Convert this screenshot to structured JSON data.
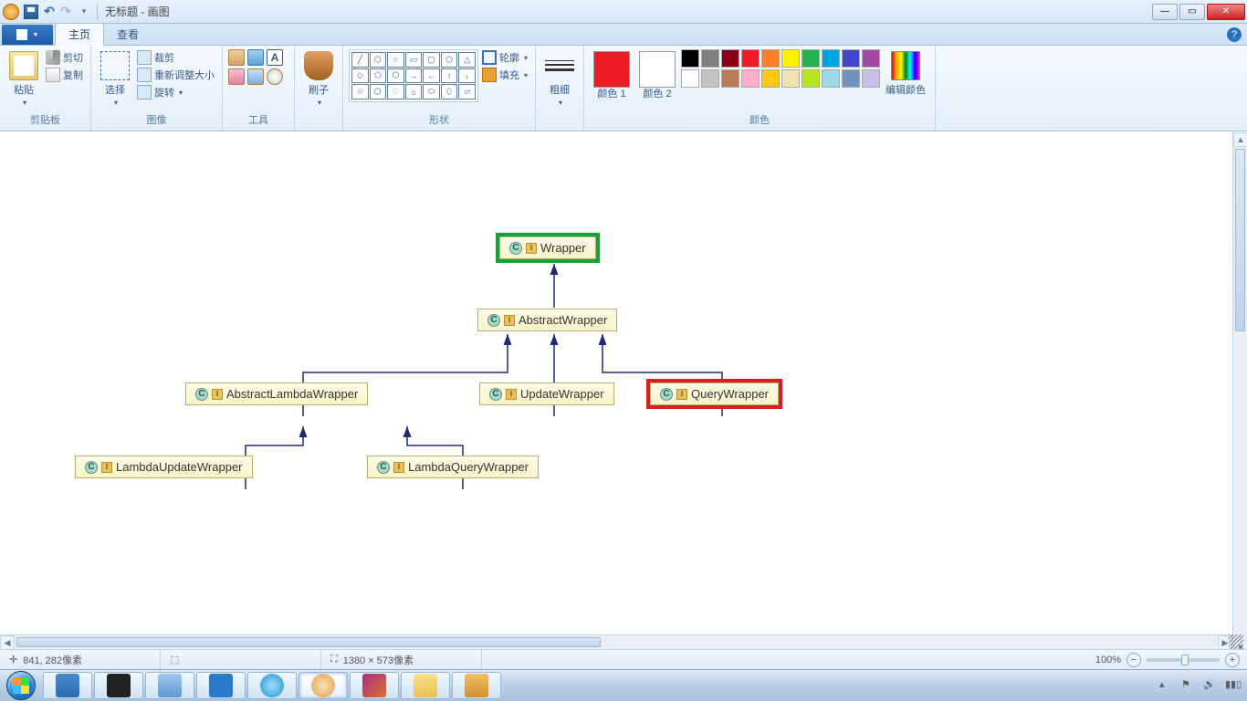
{
  "titlebar": {
    "title": "无标题 - 画图"
  },
  "tabs": {
    "file": "",
    "home": "主页",
    "view": "查看"
  },
  "ribbon": {
    "clipboard": {
      "label": "剪贴板",
      "paste": "粘贴",
      "cut": "剪切",
      "copy": "复制"
    },
    "image": {
      "label": "图像",
      "select": "选择",
      "crop": "裁剪",
      "resize": "重新调整大小",
      "rotate": "旋转"
    },
    "tools": {
      "label": "工具"
    },
    "brushes": {
      "label": "刷子"
    },
    "shapes": {
      "label": "形状",
      "outline": "轮廓",
      "fill": "填充"
    },
    "stroke": {
      "label": "粗细"
    },
    "colors": {
      "label": "颜色",
      "color1": "颜色 1",
      "color2": "颜色 2",
      "edit": "编辑颜色"
    }
  },
  "palette_row1": [
    "#000000",
    "#7f7f7f",
    "#880015",
    "#ed1c24",
    "#ff7f27",
    "#fff200",
    "#22b14c",
    "#00a2e8",
    "#3f48cc",
    "#a349a4"
  ],
  "palette_row2": [
    "#ffffff",
    "#c3c3c3",
    "#b97a57",
    "#ffaec9",
    "#ffc90e",
    "#efe4b0",
    "#b5e61d",
    "#99d9ea",
    "#7092be",
    "#c8bfe7"
  ],
  "current_color1": "#ed1c24",
  "current_color2": "#ffffff",
  "status": {
    "cursor_icon": "✛",
    "cursor": "841, 282像素",
    "selection_icon": "⬚",
    "selection": "",
    "size_icon": "⛶",
    "canvas_size": "1380 × 573像素",
    "zoom": "100%"
  },
  "diagram": {
    "nodes": {
      "wrapper": "Wrapper",
      "abstract_wrapper": "AbstractWrapper",
      "abstract_lambda_wrapper": "AbstractLambdaWrapper",
      "update_wrapper": "UpdateWrapper",
      "query_wrapper": "QueryWrapper",
      "lambda_update_wrapper": "LambdaUpdateWrapper",
      "lambda_query_wrapper": "LambdaQueryWrapper"
    }
  },
  "taskbar_apps": [
    "word",
    "cmd",
    "dolphin",
    "vscode",
    "ie",
    "paint",
    "intellij",
    "explorer",
    "vbox"
  ]
}
